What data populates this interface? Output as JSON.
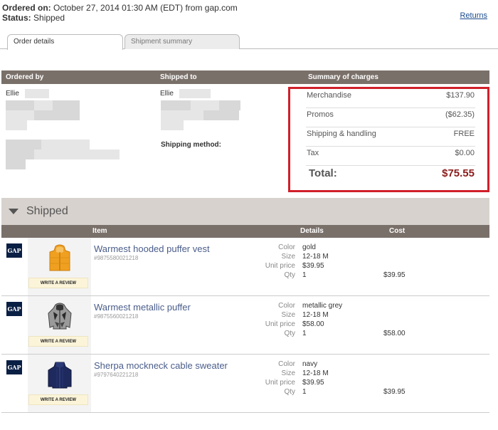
{
  "header": {
    "ordered_label": "Ordered on:",
    "ordered_value": "October 27, 2014 01:30 AM (EDT) from gap.com",
    "status_label": "Status:",
    "status_value": "Shipped",
    "returns_link": "Returns"
  },
  "tabs": [
    {
      "label": "Order details",
      "active": true
    },
    {
      "label": "Shipment summary",
      "active": false
    }
  ],
  "summary_bar": {
    "ordered_by": "Ordered by",
    "shipped_to": "Shipped to",
    "summary_of_charges": "Summary of charges"
  },
  "ordered_by_name": "Ellie",
  "shipped_to_name": "Ellie",
  "shipping_method_label": "Shipping method:",
  "charges": {
    "rows": [
      {
        "label": "Merchandise",
        "value": "$137.90"
      },
      {
        "label": "Promos",
        "value": "($62.35)"
      },
      {
        "label": "Shipping & handling",
        "value": "FREE"
      },
      {
        "label": "Tax",
        "value": "$0.00"
      }
    ],
    "total_label": "Total:",
    "total_value": "$75.55",
    "highlight_color": "#d0202a"
  },
  "shipped_section": {
    "title": "Shipped",
    "columns": {
      "item": "Item",
      "details": "Details",
      "cost": "Cost"
    }
  },
  "detail_labels": {
    "color": "Color",
    "size": "Size",
    "unit_price": "Unit price",
    "qty": "Qty"
  },
  "items": [
    {
      "brand": "GAP",
      "name": "Warmest hooded puffer vest",
      "sku": "#9875580021218",
      "review": "WRITE A REVIEW",
      "color": "gold",
      "size": "12-18 M",
      "unit_price": "$39.95",
      "qty": "1",
      "cost": "$39.95"
    },
    {
      "brand": "GAP",
      "name": "Warmest metallic puffer",
      "sku": "#9875560021218",
      "review": "WRITE A REVIEW",
      "color": "metallic grey",
      "size": "12-18 M",
      "unit_price": "$58.00",
      "qty": "1",
      "cost": "$58.00"
    },
    {
      "brand": "GAP",
      "name": "Sherpa mockneck cable sweater",
      "sku": "#9797640221218",
      "review": "WRITE A REVIEW",
      "color": "navy",
      "size": "12-18 M",
      "unit_price": "$39.95",
      "qty": "1",
      "cost": "$39.95"
    }
  ]
}
